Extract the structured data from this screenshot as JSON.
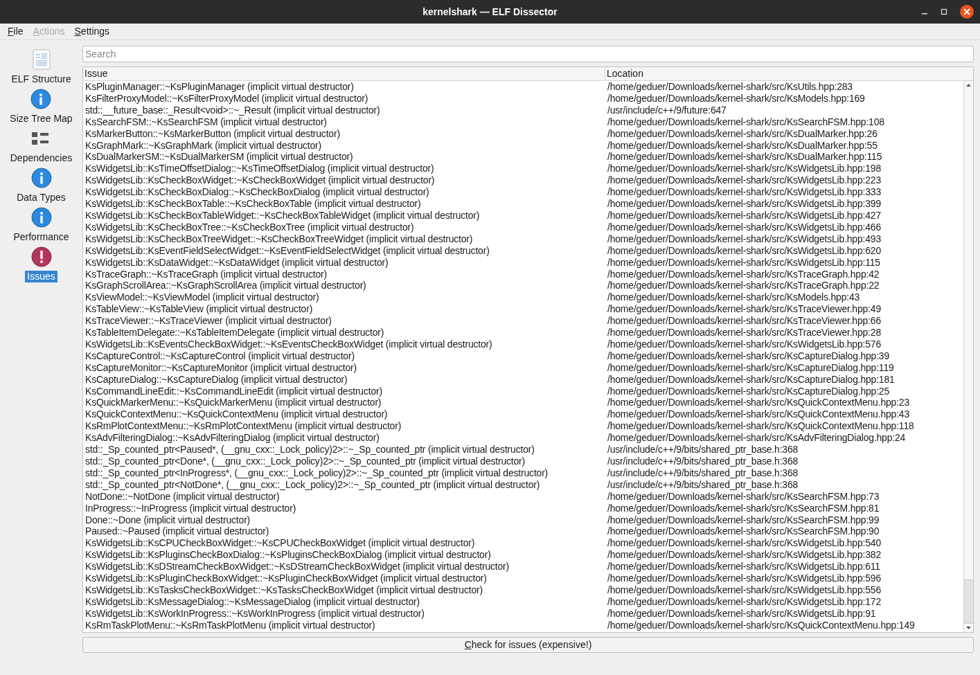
{
  "window": {
    "title": "kernelshark — ELF Dissector"
  },
  "menu": [
    {
      "label": "File",
      "disabled": false
    },
    {
      "label": "Actions",
      "disabled": true
    },
    {
      "label": "Settings",
      "disabled": false
    }
  ],
  "sidebar": {
    "items": [
      {
        "label": "ELF Structure",
        "kind": "document",
        "selected": false
      },
      {
        "label": "Size Tree Map",
        "kind": "info",
        "selected": false
      },
      {
        "label": "Dependencies",
        "kind": "list",
        "selected": false
      },
      {
        "label": "Data Types",
        "kind": "info",
        "selected": false
      },
      {
        "label": "Performance",
        "kind": "info",
        "selected": false
      },
      {
        "label": "Issues",
        "kind": "warning",
        "selected": true
      }
    ]
  },
  "search": {
    "placeholder": "Search"
  },
  "table": {
    "columns": [
      "Issue",
      "Location"
    ],
    "rows": [
      [
        "KsPluginManager::~KsPluginManager (implicit virtual destructor)",
        "/home/geduer/Downloads/kernel-shark/src/KsUtils.hpp:283"
      ],
      [
        "KsFilterProxyModel::~KsFilterProxyModel (implicit virtual destructor)",
        "/home/geduer/Downloads/kernel-shark/src/KsModels.hpp:169"
      ],
      [
        "std::__future_base::_Result<void>::~_Result (implicit virtual destructor)",
        "/usr/include/c++/9/future:647"
      ],
      [
        "KsSearchFSM::~KsSearchFSM (implicit virtual destructor)",
        "/home/geduer/Downloads/kernel-shark/src/KsSearchFSM.hpp:108"
      ],
      [
        "KsMarkerButton::~KsMarkerButton (implicit virtual destructor)",
        "/home/geduer/Downloads/kernel-shark/src/KsDualMarker.hpp:26"
      ],
      [
        "KsGraphMark::~KsGraphMark (implicit virtual destructor)",
        "/home/geduer/Downloads/kernel-shark/src/KsDualMarker.hpp:55"
      ],
      [
        "KsDualMarkerSM::~KsDualMarkerSM (implicit virtual destructor)",
        "/home/geduer/Downloads/kernel-shark/src/KsDualMarker.hpp:115"
      ],
      [
        "KsWidgetsLib::KsTimeOffsetDialog::~KsTimeOffsetDialog (implicit virtual destructor)",
        "/home/geduer/Downloads/kernel-shark/src/KsWidgetsLib.hpp:198"
      ],
      [
        "KsWidgetsLib::KsCheckBoxWidget::~KsCheckBoxWidget (implicit virtual destructor)",
        "/home/geduer/Downloads/kernel-shark/src/KsWidgetsLib.hpp:223"
      ],
      [
        "KsWidgetsLib::KsCheckBoxDialog::~KsCheckBoxDialog (implicit virtual destructor)",
        "/home/geduer/Downloads/kernel-shark/src/KsWidgetsLib.hpp:333"
      ],
      [
        "KsWidgetsLib::KsCheckBoxTable::~KsCheckBoxTable (implicit virtual destructor)",
        "/home/geduer/Downloads/kernel-shark/src/KsWidgetsLib.hpp:399"
      ],
      [
        "KsWidgetsLib::KsCheckBoxTableWidget::~KsCheckBoxTableWidget (implicit virtual destructor)",
        "/home/geduer/Downloads/kernel-shark/src/KsWidgetsLib.hpp:427"
      ],
      [
        "KsWidgetsLib::KsCheckBoxTree::~KsCheckBoxTree (implicit virtual destructor)",
        "/home/geduer/Downloads/kernel-shark/src/KsWidgetsLib.hpp:466"
      ],
      [
        "KsWidgetsLib::KsCheckBoxTreeWidget::~KsCheckBoxTreeWidget (implicit virtual destructor)",
        "/home/geduer/Downloads/kernel-shark/src/KsWidgetsLib.hpp:493"
      ],
      [
        "KsWidgetsLib::KsEventFieldSelectWidget::~KsEventFieldSelectWidget (implicit virtual destructor)",
        "/home/geduer/Downloads/kernel-shark/src/KsWidgetsLib.hpp:620"
      ],
      [
        "KsWidgetsLib::KsDataWidget::~KsDataWidget (implicit virtual destructor)",
        "/home/geduer/Downloads/kernel-shark/src/KsWidgetsLib.hpp:115"
      ],
      [
        "KsTraceGraph::~KsTraceGraph (implicit virtual destructor)",
        "/home/geduer/Downloads/kernel-shark/src/KsTraceGraph.hpp:42"
      ],
      [
        "KsGraphScrollArea::~KsGraphScrollArea (implicit virtual destructor)",
        "/home/geduer/Downloads/kernel-shark/src/KsTraceGraph.hpp:22"
      ],
      [
        "KsViewModel::~KsViewModel (implicit virtual destructor)",
        "/home/geduer/Downloads/kernel-shark/src/KsModels.hpp:43"
      ],
      [
        "KsTableView::~KsTableView (implicit virtual destructor)",
        "/home/geduer/Downloads/kernel-shark/src/KsTraceViewer.hpp:49"
      ],
      [
        "KsTraceViewer::~KsTraceViewer (implicit virtual destructor)",
        "/home/geduer/Downloads/kernel-shark/src/KsTraceViewer.hpp:66"
      ],
      [
        "KsTableItemDelegate::~KsTableItemDelegate (implicit virtual destructor)",
        "/home/geduer/Downloads/kernel-shark/src/KsTraceViewer.hpp:28"
      ],
      [
        "KsWidgetsLib::KsEventsCheckBoxWidget::~KsEventsCheckBoxWidget (implicit virtual destructor)",
        "/home/geduer/Downloads/kernel-shark/src/KsWidgetsLib.hpp:576"
      ],
      [
        "KsCaptureControl::~KsCaptureControl (implicit virtual destructor)",
        "/home/geduer/Downloads/kernel-shark/src/KsCaptureDialog.hpp:39"
      ],
      [
        "KsCaptureMonitor::~KsCaptureMonitor (implicit virtual destructor)",
        "/home/geduer/Downloads/kernel-shark/src/KsCaptureDialog.hpp:119"
      ],
      [
        "KsCaptureDialog::~KsCaptureDialog (implicit virtual destructor)",
        "/home/geduer/Downloads/kernel-shark/src/KsCaptureDialog.hpp:181"
      ],
      [
        "KsCommandLineEdit::~KsCommandLineEdit (implicit virtual destructor)",
        "/home/geduer/Downloads/kernel-shark/src/KsCaptureDialog.hpp:25"
      ],
      [
        "KsQuickMarkerMenu::~KsQuickMarkerMenu (implicit virtual destructor)",
        "/home/geduer/Downloads/kernel-shark/src/KsQuickContextMenu.hpp:23"
      ],
      [
        "KsQuickContextMenu::~KsQuickContextMenu (implicit virtual destructor)",
        "/home/geduer/Downloads/kernel-shark/src/KsQuickContextMenu.hpp:43"
      ],
      [
        "KsRmPlotContextMenu::~KsRmPlotContextMenu (implicit virtual destructor)",
        "/home/geduer/Downloads/kernel-shark/src/KsQuickContextMenu.hpp:118"
      ],
      [
        "KsAdvFilteringDialog::~KsAdvFilteringDialog (implicit virtual destructor)",
        "/home/geduer/Downloads/kernel-shark/src/KsAdvFilteringDialog.hpp:24"
      ],
      [
        "std::_Sp_counted_ptr<Paused*, (__gnu_cxx::_Lock_policy)2>::~_Sp_counted_ptr (implicit virtual destructor)",
        "/usr/include/c++/9/bits/shared_ptr_base.h:368"
      ],
      [
        "std::_Sp_counted_ptr<Done*, (__gnu_cxx::_Lock_policy)2>::~_Sp_counted_ptr (implicit virtual destructor)",
        "/usr/include/c++/9/bits/shared_ptr_base.h:368"
      ],
      [
        "std::_Sp_counted_ptr<InProgress*, (__gnu_cxx::_Lock_policy)2>::~_Sp_counted_ptr (implicit virtual destructor)",
        "/usr/include/c++/9/bits/shared_ptr_base.h:368"
      ],
      [
        "std::_Sp_counted_ptr<NotDone*, (__gnu_cxx::_Lock_policy)2>::~_Sp_counted_ptr (implicit virtual destructor)",
        "/usr/include/c++/9/bits/shared_ptr_base.h:368"
      ],
      [
        "NotDone::~NotDone (implicit virtual destructor)",
        "/home/geduer/Downloads/kernel-shark/src/KsSearchFSM.hpp:73"
      ],
      [
        "InProgress::~InProgress (implicit virtual destructor)",
        "/home/geduer/Downloads/kernel-shark/src/KsSearchFSM.hpp:81"
      ],
      [
        "Done::~Done (implicit virtual destructor)",
        "/home/geduer/Downloads/kernel-shark/src/KsSearchFSM.hpp:99"
      ],
      [
        "Paused::~Paused (implicit virtual destructor)",
        "/home/geduer/Downloads/kernel-shark/src/KsSearchFSM.hpp:90"
      ],
      [
        "KsWidgetsLib::KsCPUCheckBoxWidget::~KsCPUCheckBoxWidget (implicit virtual destructor)",
        "/home/geduer/Downloads/kernel-shark/src/KsWidgetsLib.hpp:540"
      ],
      [
        "KsWidgetsLib::KsPluginsCheckBoxDialog::~KsPluginsCheckBoxDialog (implicit virtual destructor)",
        "/home/geduer/Downloads/kernel-shark/src/KsWidgetsLib.hpp:382"
      ],
      [
        "KsWidgetsLib::KsDStreamCheckBoxWidget::~KsDStreamCheckBoxWidget (implicit virtual destructor)",
        "/home/geduer/Downloads/kernel-shark/src/KsWidgetsLib.hpp:611"
      ],
      [
        "KsWidgetsLib::KsPluginCheckBoxWidget::~KsPluginCheckBoxWidget (implicit virtual destructor)",
        "/home/geduer/Downloads/kernel-shark/src/KsWidgetsLib.hpp:596"
      ],
      [
        "KsWidgetsLib::KsTasksCheckBoxWidget::~KsTasksCheckBoxWidget (implicit virtual destructor)",
        "/home/geduer/Downloads/kernel-shark/src/KsWidgetsLib.hpp:556"
      ],
      [
        "KsWidgetsLib::KsMessageDialog::~KsMessageDialog (implicit virtual destructor)",
        "/home/geduer/Downloads/kernel-shark/src/KsWidgetsLib.hpp:172"
      ],
      [
        "KsWidgetsLib::KsWorkInProgress::~KsWorkInProgress (implicit virtual destructor)",
        "/home/geduer/Downloads/kernel-shark/src/KsWidgetsLib.hpp:91"
      ],
      [
        "KsRmTaskPlotMenu::~KsRmTaskPlotMenu (implicit virtual destructor)",
        "/home/geduer/Downloads/kernel-shark/src/KsQuickContextMenu.hpp:149"
      ]
    ]
  },
  "button": {
    "label": "Check for issues (expensive!)"
  }
}
